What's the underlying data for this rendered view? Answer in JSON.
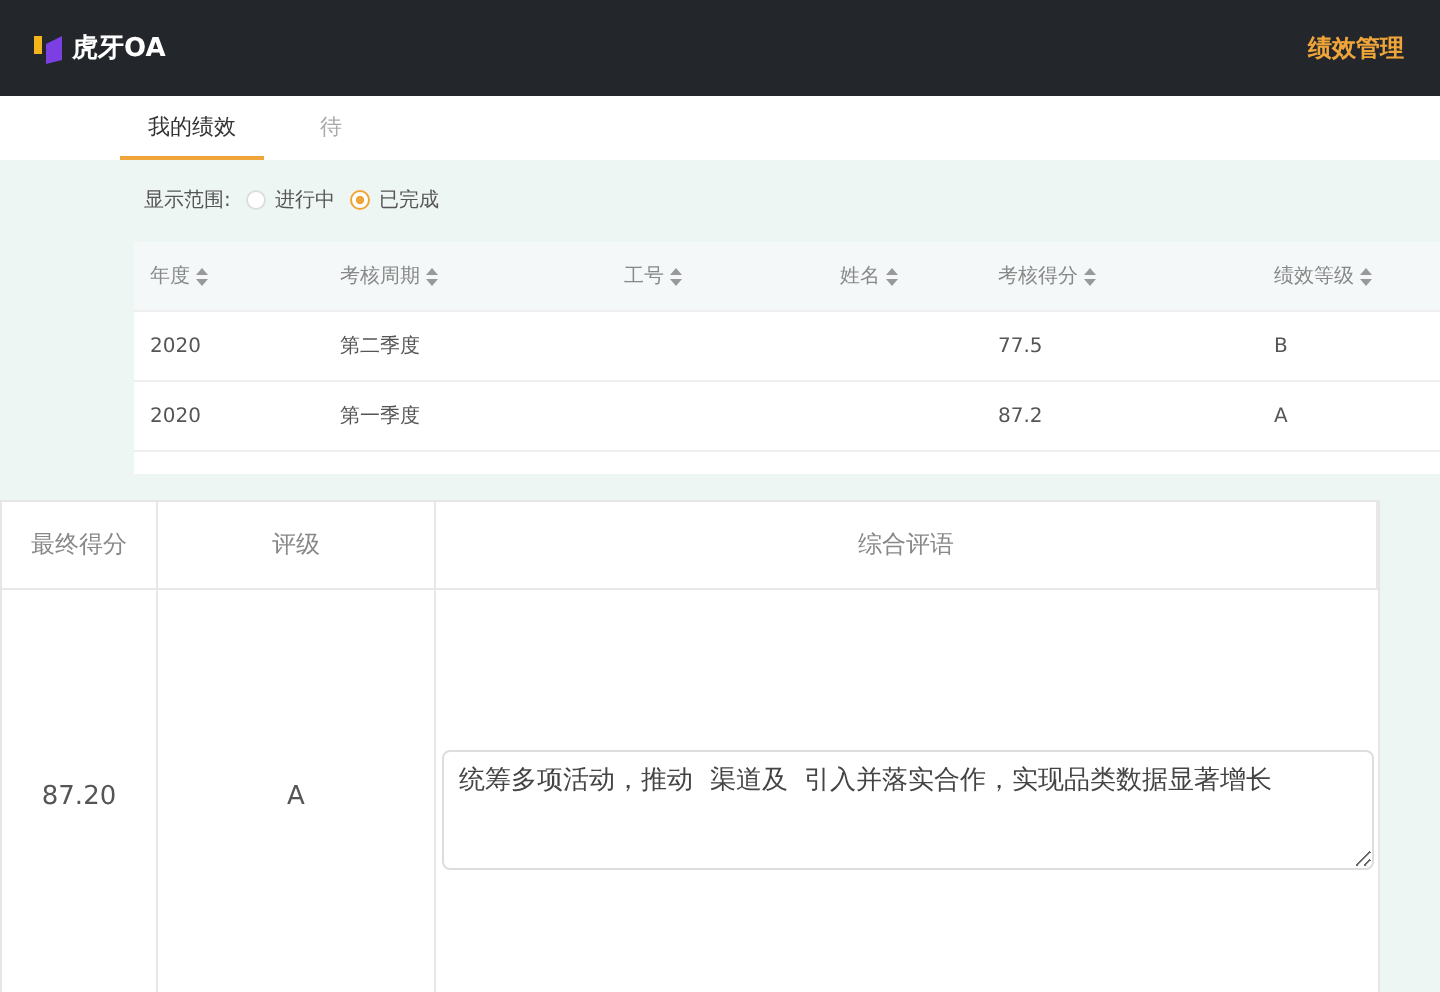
{
  "header": {
    "brand": "虎牙OA",
    "nav": "绩效管理"
  },
  "tabs": [
    {
      "label": "我的绩效",
      "selected": true
    },
    {
      "label": "待",
      "selected": false
    }
  ],
  "filter": {
    "label": "显示范围:",
    "options": [
      {
        "label": "进行中",
        "selected": false
      },
      {
        "label": "已完成",
        "selected": true
      }
    ]
  },
  "table": {
    "columns": [
      "年度",
      "考核周期",
      "工号",
      "姓名",
      "考核得分",
      "绩效等级"
    ],
    "rows": [
      [
        "2020",
        "第二季度",
        "",
        "",
        "77.5",
        "B"
      ],
      [
        "2020",
        "第一季度",
        "",
        "",
        "87.2",
        "A"
      ]
    ]
  },
  "detail": {
    "columns": [
      "最终得分",
      "评级",
      "综合评语"
    ],
    "score": "87.20",
    "grade": "A",
    "comment": "统筹多项活动，推动  渠道及  引入并落实合作，实现品类数据显著增长"
  }
}
